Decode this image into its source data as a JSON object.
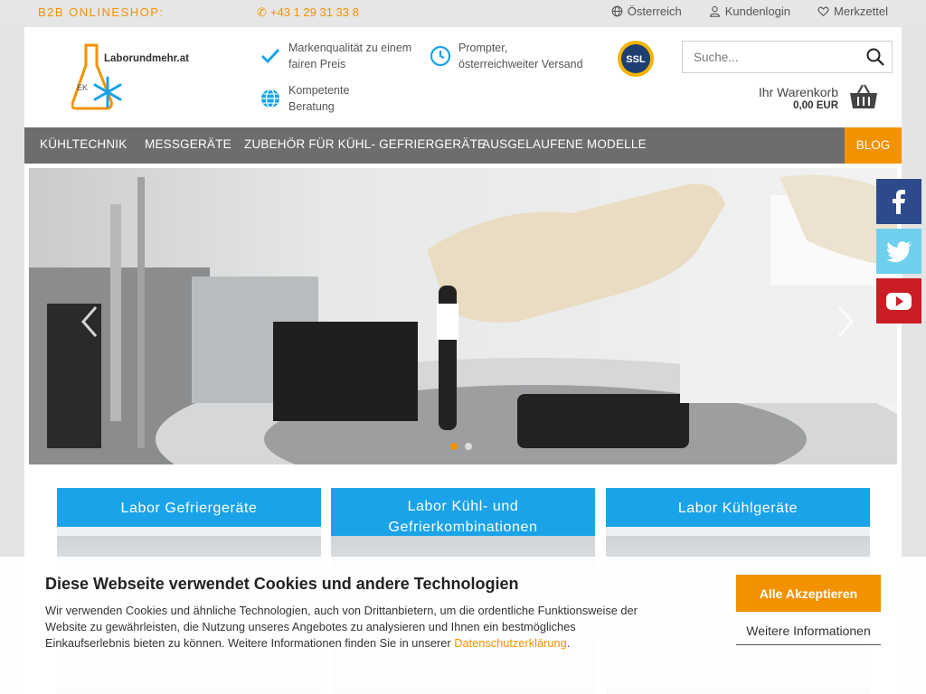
{
  "topbar": {
    "label": "B2B ONLINESHOP:",
    "phone": "+43 1 29 31 33 8",
    "links": [
      {
        "label": "Österreich",
        "icon": "globe-icon"
      },
      {
        "label": "Kundenlogin",
        "icon": "user-icon"
      },
      {
        "label": "Merkzettel",
        "icon": "heart-icon"
      }
    ]
  },
  "header": {
    "logo_text": "Laborundmehr.at",
    "usps": [
      {
        "text1": "Markenqualität zu einem",
        "text2": "fairen Preis",
        "icon": "checkmark-icon"
      },
      {
        "text1": "Prompter,",
        "text2": "österreichweiter Versand",
        "icon": "clock-icon"
      },
      {
        "text1": "Kompetente",
        "text2": "Beratung",
        "icon": "globe-icon"
      }
    ],
    "ssl_badge": "SSL",
    "search_placeholder": "Suche...",
    "cart_label": "Ihr Warenkorb",
    "cart_value": "0,00 EUR"
  },
  "nav": {
    "items": [
      "KÜHLTECHNIK",
      "MESSGERÄTE",
      "ZUBEHÖR FÜR KÜHL- GEFRIERGERÄTE",
      "AUSGELAUFENE MODELLE"
    ],
    "blog": "BLOG"
  },
  "categories": [
    {
      "title": "Labor Gefriergeräte"
    },
    {
      "title": "Labor Kühl- und Gefrierkombinationen"
    },
    {
      "title": "Labor Kühlgeräte"
    }
  ],
  "cookie": {
    "title": "Diese Webseite verwendet Cookies und andere Technologien",
    "text": "Wir verwenden Cookies und ähnliche Technologien, auch von Drittanbietern, um die ordentliche Funktionsweise der Website zu gewährleisten, die Nutzung unseres Angebotes zu analysieren und Ihnen ein bestmögliches Einkaufserlebnis bieten zu können. Weitere Informationen finden Sie in unserer ",
    "link": "Datenschutzerklärung",
    "link_suffix": ".",
    "accept": "Alle Akzeptieren",
    "more": "Weitere Informationen"
  },
  "colors": {
    "accent": "#f39200",
    "blue": "#1aa3e8",
    "nav": "#6d6d6d"
  }
}
